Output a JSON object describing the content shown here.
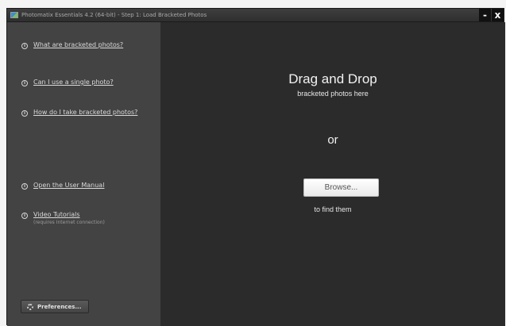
{
  "window": {
    "title": "Photomatix Essentials  4.2 (64-bit) - Step 1: Load Bracketed Photos",
    "minimize_label": "-",
    "close_label": "x"
  },
  "sidebar": {
    "links": [
      {
        "label": "What are bracketed photos?",
        "icon": "info-icon"
      },
      {
        "label": "Can I use a single photo?",
        "icon": "info-icon"
      },
      {
        "label": "How do I take bracketed photos?",
        "icon": "info-icon"
      },
      {
        "label": "Open the User Manual",
        "icon": "info-icon"
      },
      {
        "label": "Video Tutorials",
        "sub": "(requires Internet connection)",
        "icon": "info-icon"
      }
    ],
    "info_glyph": "i",
    "preferences_label": "Preferences..."
  },
  "main": {
    "drop_title": "Drag and Drop",
    "drop_subtitle": "bracketed photos here",
    "or_label": "or",
    "browse_label": "Browse...",
    "find_label": "to find them"
  },
  "colors": {
    "sidebar_bg": "#434343",
    "main_bg": "#2b2b2b",
    "titlebar_bg": "#333333"
  }
}
